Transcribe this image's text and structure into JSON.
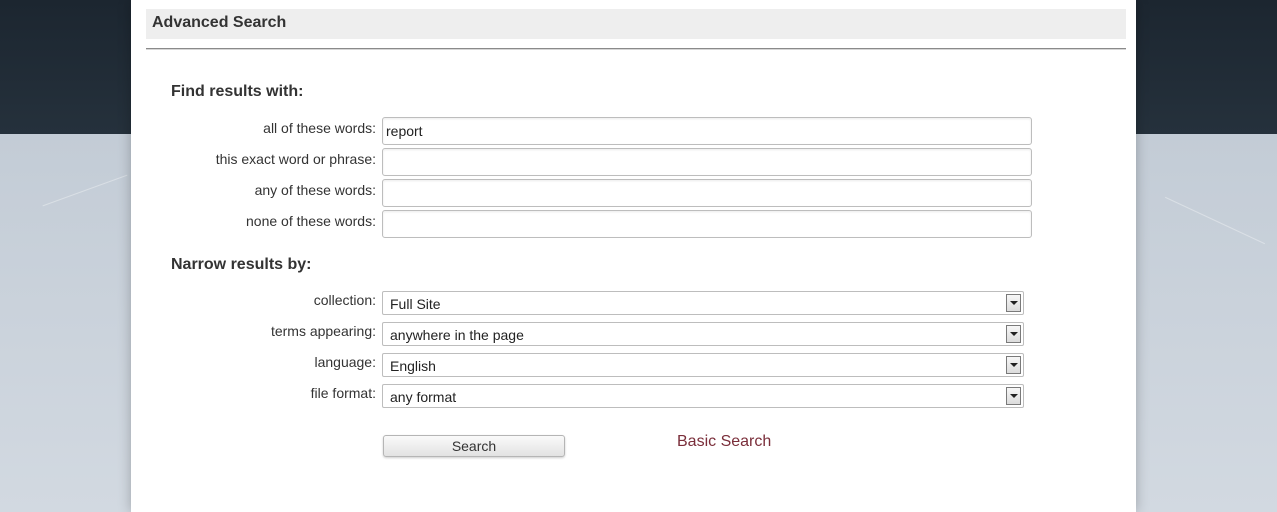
{
  "page": {
    "title": "Advanced Search"
  },
  "find_section": {
    "heading": "Find results with:",
    "fields": [
      {
        "label": "all of these words:",
        "value": "report"
      },
      {
        "label": "this exact word or phrase:",
        "value": ""
      },
      {
        "label": "any of these words:",
        "value": ""
      },
      {
        "label": "none of these words:",
        "value": ""
      }
    ]
  },
  "narrow_section": {
    "heading": "Narrow results by:",
    "selects": [
      {
        "label": "collection:",
        "value": "Full Site"
      },
      {
        "label": "terms appearing:",
        "value": "anywhere in the page"
      },
      {
        "label": "language:",
        "value": "English"
      },
      {
        "label": "file format:",
        "value": "any format"
      }
    ]
  },
  "actions": {
    "search_label": "Search",
    "basic_search_label": "Basic Search"
  },
  "colors": {
    "link": "#7a2e3a",
    "header_bg": "#eeeeee"
  }
}
